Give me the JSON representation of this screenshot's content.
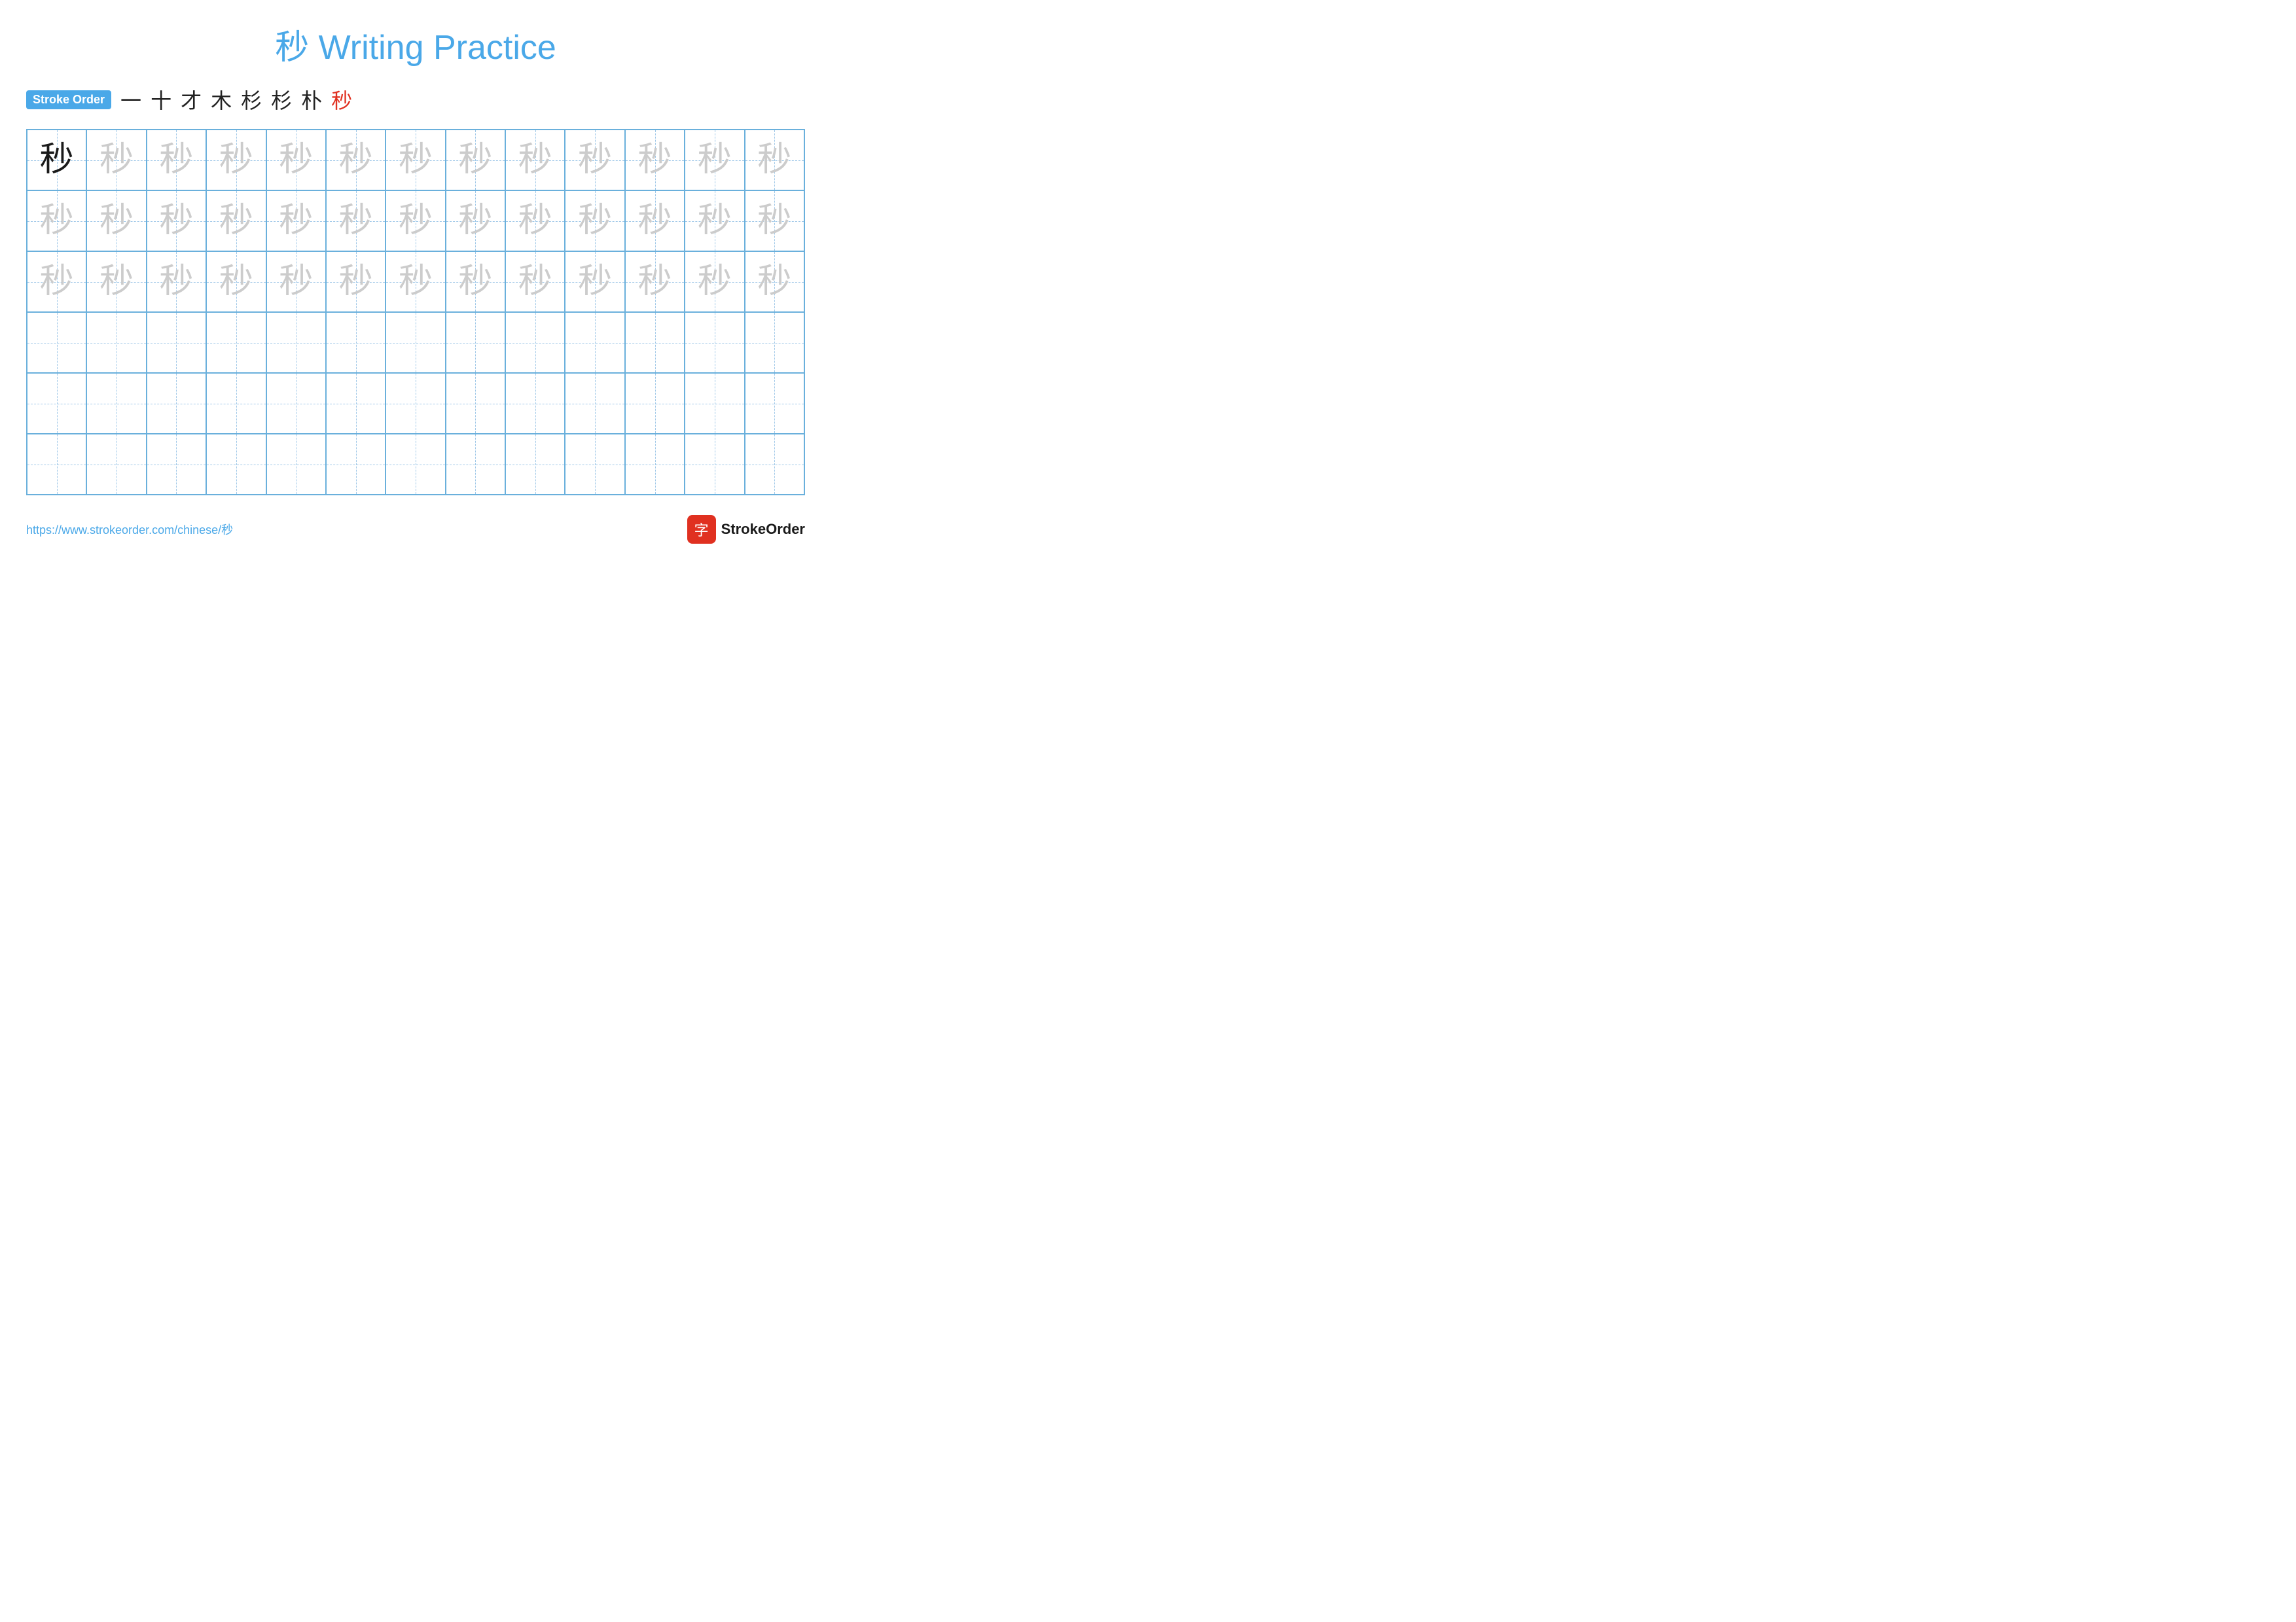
{
  "title": {
    "char": "秒",
    "text": " Writing Practice"
  },
  "stroke_order": {
    "badge_label": "Stroke Order",
    "steps": [
      "一",
      "十",
      "才",
      "木",
      "杉",
      "杉",
      "朴",
      "秒"
    ]
  },
  "grid": {
    "rows": 6,
    "cols": 13,
    "solid_char": "秒",
    "ghost_char": "秒",
    "solid_cells": [
      {
        "row": 0,
        "col": 0
      }
    ],
    "ghost_rows": [
      0,
      1,
      2
    ],
    "empty_rows": [
      3,
      4,
      5
    ]
  },
  "footer": {
    "url": "https://www.strokeorder.com/chinese/秒",
    "logo_char": "字",
    "logo_text": "StrokeOrder"
  }
}
